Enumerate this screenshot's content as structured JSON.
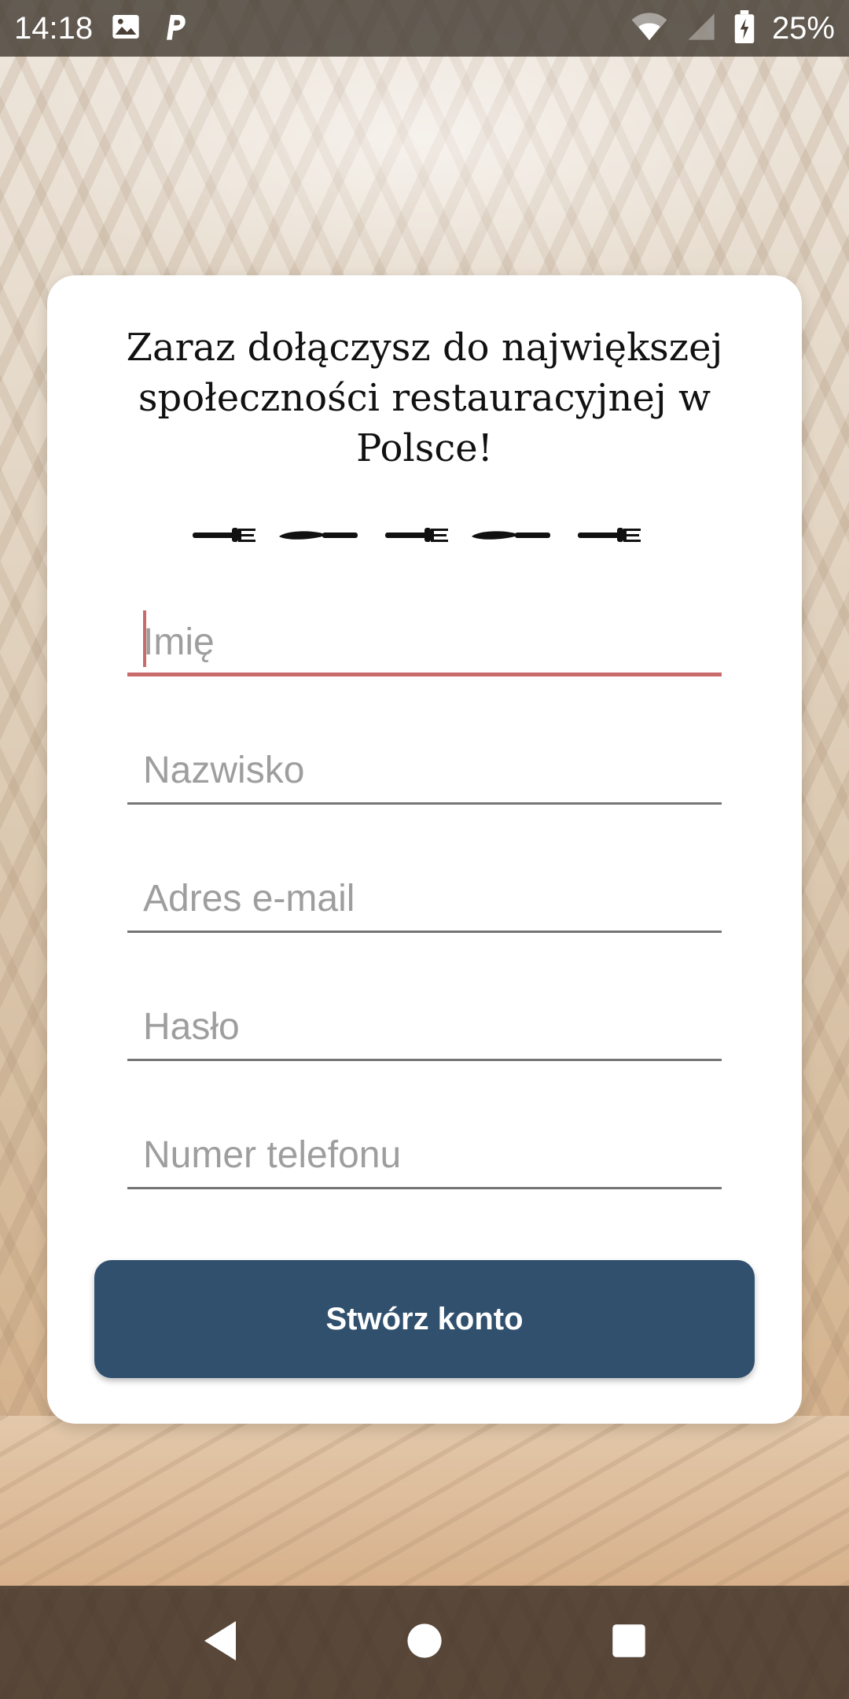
{
  "status_bar": {
    "time": "14:18",
    "battery_percent": "25%",
    "icons": [
      "image-icon",
      "parking-icon",
      "wifi-icon",
      "signal-icon",
      "battery-charging-icon"
    ]
  },
  "card": {
    "title": "Zaraz dołączysz do największej społeczności restauracyjnej w Polsce!",
    "divider_icon": "cutlery-divider-icon"
  },
  "form": {
    "first_name": {
      "placeholder": "Imię",
      "value": ""
    },
    "last_name": {
      "placeholder": "Nazwisko",
      "value": ""
    },
    "email": {
      "placeholder": "Adres e-mail",
      "value": ""
    },
    "password": {
      "placeholder": "Hasło",
      "value": ""
    },
    "phone": {
      "placeholder": "Numer telefonu",
      "value": ""
    },
    "submit_label": "Stwórz konto"
  },
  "nav_bar": {
    "buttons": [
      "back-icon",
      "home-icon",
      "recents-icon"
    ]
  },
  "colors": {
    "accent": "#c96a6b",
    "button": "#30506e",
    "card": "#ffffff"
  }
}
